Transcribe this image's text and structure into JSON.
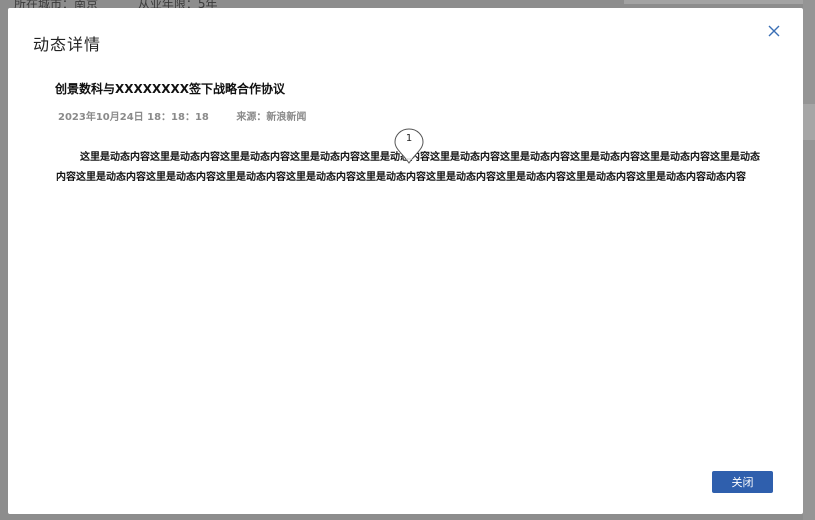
{
  "background": {
    "city_text": "所在城市：南京",
    "years_text": "从业年限：5年"
  },
  "modal": {
    "title": "动态详情",
    "article_title": "创景数科与XXXXXXXX签下战略合作协议",
    "date": "2023年10月24日 18：18：18",
    "source": "来源：新浪新闻",
    "body": "这里是动态内容这里是动态内容这里是动态内容这里是动态内容这里是动态内容这里是动态内容这里是动态内容这里是动态内容这里是动态内容这里是动态内容这里是动态内容这里是动态内容这里是动态内容这里是动态内容这里是动态内容这里是动态内容这里是动态内容这里是动态内容这里是动态内容动态内容",
    "marker_number": "1",
    "close_button_label": "关闭"
  },
  "colors": {
    "primary": "#2f5fad",
    "overlay": "#8c8c8c",
    "close_icon": "#3a6fb5"
  }
}
